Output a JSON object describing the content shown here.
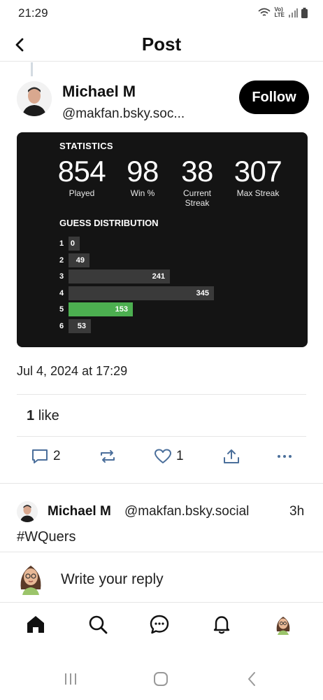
{
  "status_bar": {
    "time": "21:29",
    "lte_top": "Vo)",
    "lte_bottom": "LTE"
  },
  "header": {
    "title": "Post"
  },
  "post": {
    "author_name": "Michael M",
    "author_handle": "@makfan.bsky.soc...",
    "follow_label": "Follow",
    "date": "Jul 4, 2024 at 17:29",
    "likes_count": "1",
    "likes_label": "like"
  },
  "stats_card": {
    "title": "STATISTICS",
    "stats": [
      {
        "value": "854",
        "label": "Played",
        "label2": ""
      },
      {
        "value": "98",
        "label": "Win %",
        "label2": ""
      },
      {
        "value": "38",
        "label": "Current",
        "label2": "Streak"
      },
      {
        "value": "307",
        "label": "Max Streak",
        "label2": ""
      }
    ],
    "distribution_title": "GUESS DISTRIBUTION",
    "distribution": [
      {
        "guess": "1",
        "count": 0,
        "label": "0",
        "active": false
      },
      {
        "guess": "2",
        "count": 49,
        "label": "49",
        "active": false
      },
      {
        "guess": "3",
        "count": 241,
        "label": "241",
        "active": false
      },
      {
        "guess": "4",
        "count": 345,
        "label": "345",
        "active": false
      },
      {
        "guess": "5",
        "count": 153,
        "label": "153",
        "active": true
      },
      {
        "guess": "6",
        "count": 53,
        "label": "53",
        "active": false
      }
    ],
    "active_color": "#4caf50",
    "bar_color": "#3a3a3a"
  },
  "actions": {
    "reply_count": "2",
    "like_count": "1"
  },
  "reply": {
    "author_name": "Michael M",
    "author_handle": "@makfan.bsky.social",
    "time": "3h",
    "text": "#WQuers"
  },
  "compose": {
    "placeholder": "Write your reply"
  },
  "colors": {
    "accent": "#4b6f9b",
    "text": "#111111"
  }
}
